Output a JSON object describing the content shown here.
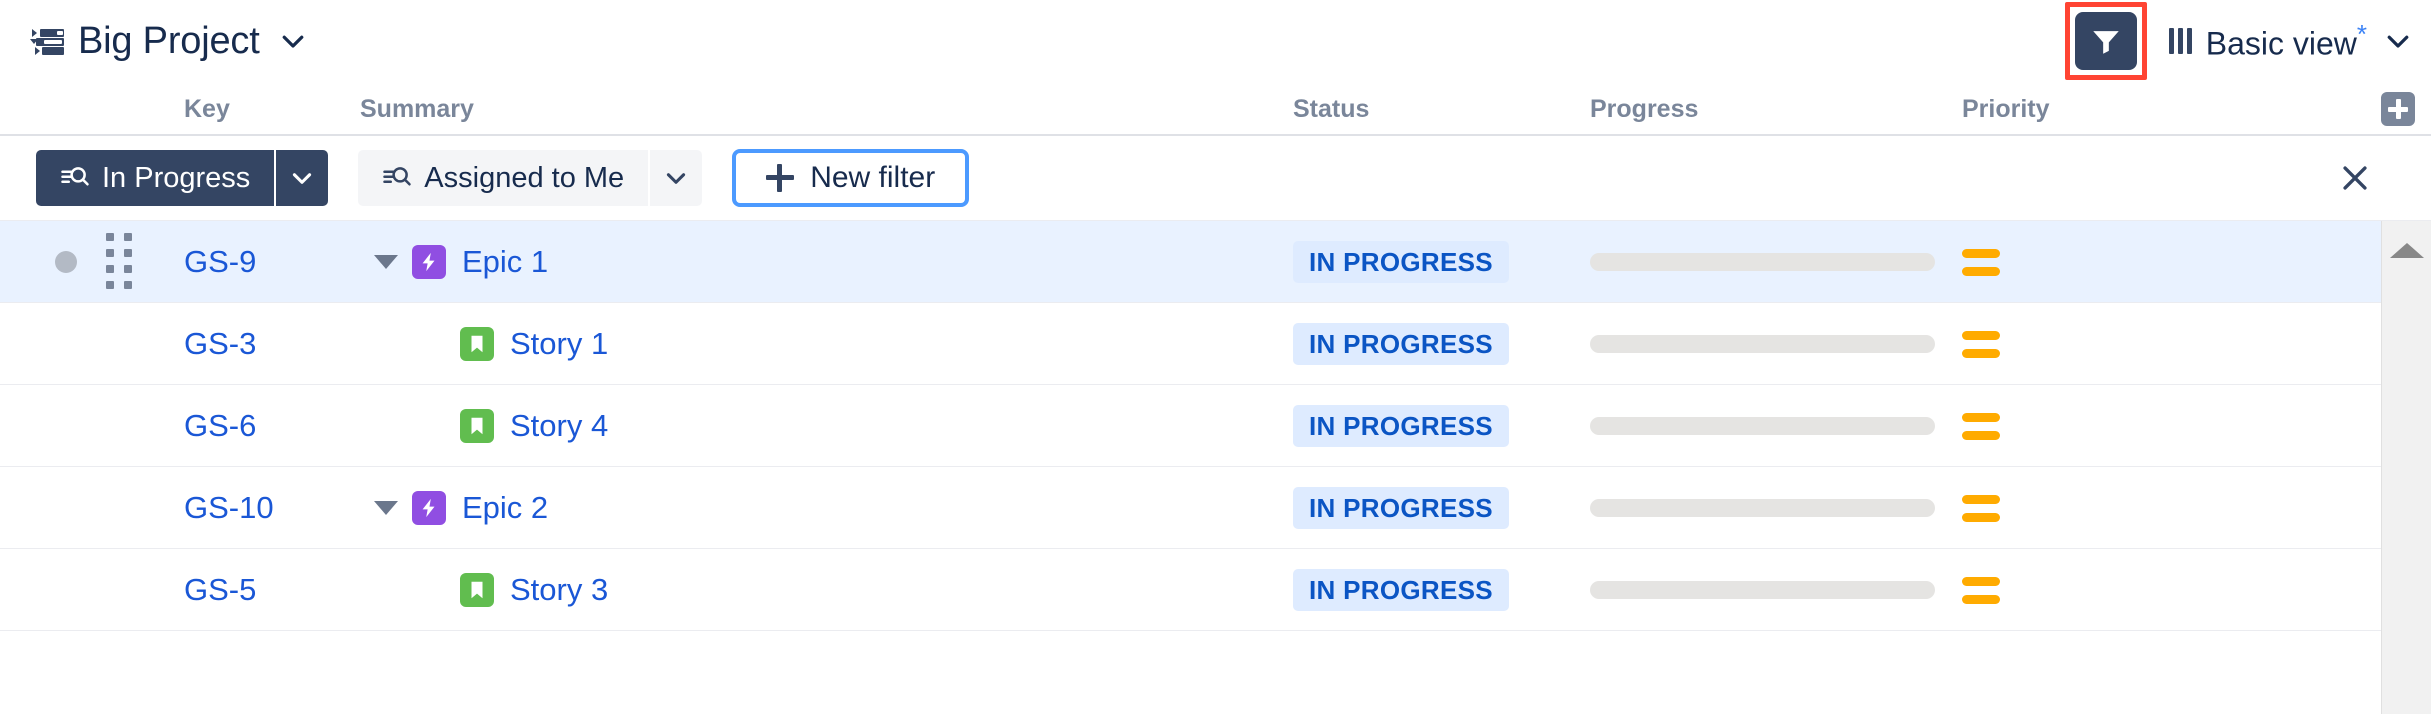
{
  "header": {
    "project_icon": "hierarchy-list-icon",
    "project_name": "Big Project",
    "project_caret": "chevron-down-icon",
    "filter_button_icon": "funnel-icon",
    "filter_button_highlight_color": "#FF4433",
    "filter_button_bg": "#344563",
    "columns_icon": "columns-icon",
    "view_label": "Basic view",
    "view_modified_marker": "*",
    "view_caret": "chevron-down-icon",
    "accent_blue": "#1A57D6",
    "text_dark": "#172B4D"
  },
  "columns": {
    "key": "Key",
    "summary": "Summary",
    "status": "Status",
    "progress": "Progress",
    "priority": "Priority",
    "add_column_icon": "plus-icon"
  },
  "filter_bar": {
    "filters": [
      {
        "label": "In Progress",
        "icon": "saved-filter-icon",
        "active": true,
        "caret": "chevron-down-icon"
      },
      {
        "label": "Assigned to Me",
        "icon": "saved-filter-icon",
        "active": false,
        "caret": "chevron-down-icon"
      }
    ],
    "new_filter_label": "New filter",
    "new_filter_plus": "plus-icon",
    "new_filter_border_color": "#4C9AFF",
    "close_icon": "close-icon"
  },
  "table": {
    "rows": [
      {
        "key": "GS-9",
        "summary": "Epic 1",
        "type": "epic",
        "type_icon": "epic-bolt-icon",
        "type_color": "#904EE2",
        "indent": 0,
        "expandable": true,
        "expanded": true,
        "status": "IN PROGRESS",
        "progress": 0,
        "priority": "Medium",
        "priority_icon": "priority-medium-icon",
        "priority_color": "#FFAB00",
        "selected": true,
        "has_drag_handle": true,
        "has_status_dot": true
      },
      {
        "key": "GS-3",
        "summary": "Story 1",
        "type": "story",
        "type_icon": "story-bookmark-icon",
        "type_color": "#61BD4F",
        "indent": 1,
        "expandable": false,
        "expanded": false,
        "status": "IN PROGRESS",
        "progress": 0,
        "priority": "Medium",
        "priority_icon": "priority-medium-icon",
        "priority_color": "#FFAB00",
        "selected": false,
        "has_drag_handle": false,
        "has_status_dot": false
      },
      {
        "key": "GS-6",
        "summary": "Story 4",
        "type": "story",
        "type_icon": "story-bookmark-icon",
        "type_color": "#61BD4F",
        "indent": 1,
        "expandable": false,
        "expanded": false,
        "status": "IN PROGRESS",
        "progress": 0,
        "priority": "Medium",
        "priority_icon": "priority-medium-icon",
        "priority_color": "#FFAB00",
        "selected": false,
        "has_drag_handle": false,
        "has_status_dot": false
      },
      {
        "key": "GS-10",
        "summary": "Epic 2",
        "type": "epic",
        "type_icon": "epic-bolt-icon",
        "type_color": "#904EE2",
        "indent": 0,
        "expandable": true,
        "expanded": true,
        "status": "IN PROGRESS",
        "progress": 0,
        "priority": "Medium",
        "priority_icon": "priority-medium-icon",
        "priority_color": "#FFAB00",
        "selected": false,
        "has_drag_handle": false,
        "has_status_dot": false
      },
      {
        "key": "GS-5",
        "summary": "Story 3",
        "type": "story",
        "type_icon": "story-bookmark-icon",
        "type_color": "#61BD4F",
        "indent": 1,
        "expandable": false,
        "expanded": false,
        "status": "IN PROGRESS",
        "progress": 0,
        "priority": "Medium",
        "priority_icon": "priority-medium-icon",
        "priority_color": "#FFAB00",
        "selected": false,
        "has_drag_handle": false,
        "has_status_dot": false
      }
    ]
  },
  "scrollbar": {
    "up_arrow_icon": "caret-up-icon"
  }
}
